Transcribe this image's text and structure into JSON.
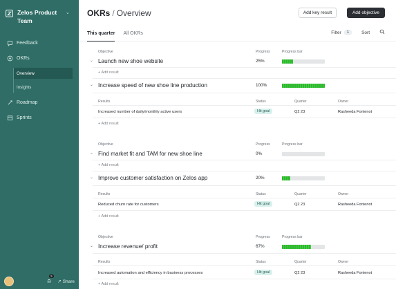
{
  "sidebar": {
    "team_name": "Zelos Product Team",
    "items": [
      {
        "label": "Feedback",
        "icon": "feedback-icon"
      },
      {
        "label": "OKRs",
        "icon": "target-icon"
      },
      {
        "label": "Roadmap",
        "icon": "roadmap-icon"
      },
      {
        "label": "Sprints",
        "icon": "calendar-icon"
      }
    ],
    "sub_items": [
      {
        "label": "Overview",
        "active": true
      },
      {
        "label": "Insights",
        "active": false
      }
    ],
    "footer": {
      "notification_count": "5",
      "share_label": "Share"
    }
  },
  "header": {
    "title": "OKRs",
    "subtitle": "Overview",
    "add_key_result": "Add key result",
    "add_objective": "Add objective"
  },
  "tabs": [
    {
      "label": "This quarter",
      "active": true
    },
    {
      "label": "All OKRs",
      "active": false
    }
  ],
  "tools": {
    "filter_label": "Filter",
    "filter_count": "1",
    "sort_label": "Sort"
  },
  "columns": {
    "objective": "Objective",
    "progress": "Progress",
    "progress_bar": "Progress bar",
    "results": "Results",
    "status": "Status",
    "quarter": "Quarter",
    "owner": "Owner"
  },
  "add_result_label": "+ Add result",
  "objectives": [
    {
      "title": "Launch new shoe website",
      "progress": "25%",
      "progress_value": 0.25
    },
    {
      "title": "Increase speed of new shoe line production",
      "progress": "100%",
      "progress_value": 1.0,
      "results": [
        {
          "text": "Increased number of daily/monthly active users",
          "status": "Hit goal",
          "quarter": "Q2 23",
          "owner": "Rasheeda Fontenot"
        }
      ]
    },
    {
      "title": "Find market fit and TAM for new shoe line",
      "progress": "0%",
      "progress_value": 0.0
    },
    {
      "title": "Improve customer satisfaction on Zelos app",
      "progress": "20%",
      "progress_value": 0.2,
      "results": [
        {
          "text": "Reduced churn rate for customers",
          "status": "Hit goal",
          "quarter": "Q2 23",
          "owner": "Rasheeda Fontenot"
        }
      ]
    },
    {
      "title": "Increase revenue/ profit",
      "progress": "67%",
      "progress_value": 0.67,
      "results": [
        {
          "text": "Increased automation and efficiency in business processes",
          "status": "Hit goal",
          "quarter": "Q2 23",
          "owner": "Rasheeda Fontenot"
        }
      ]
    }
  ],
  "colors": {
    "sidebar_bg": "#2f6d66",
    "progress_green": "#35c236",
    "pill_bg": "#d8f0ec",
    "primary_button": "#2b2e33"
  }
}
